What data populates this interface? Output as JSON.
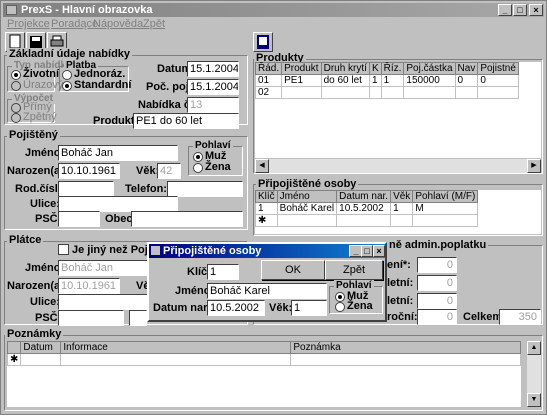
{
  "window": {
    "title": "PrexS - Hlavní obrazovka"
  },
  "menu": [
    "Projekce",
    "Poradące",
    "Nápověda",
    "Zpět"
  ],
  "basic": {
    "title": "Základní údaje nabídky",
    "typ_title": "Typ nabídky",
    "typ_opts": [
      "Životní",
      "Úrazový"
    ],
    "platba_title": "Platba",
    "platba_opts": [
      "Jednoráz.",
      "Standardní"
    ],
    "vypocet_title": "Výpočet",
    "vypocet_opts": [
      "Přímý",
      "Zpětný"
    ],
    "datum_label": "Datum:",
    "datum_value": "15.1.2004",
    "poc_label": "Poč. poj.:",
    "poc_value": "15.1.2004",
    "nabidka_label": "Nabídka č.:",
    "nabidka_value": "13",
    "produkt_label": "Produkt:",
    "produkt_value": "PE1 do 60 let"
  },
  "pojisteny": {
    "title": "Pojištěný",
    "jmeno_label": "Jméno:",
    "jmeno_value": "Boháč Jan",
    "narozen_label": "Narozen(a):",
    "narozen_value": "10.10.1961",
    "vek_label": "Věk:",
    "vek_value": "42",
    "pohlavi_title": "Pohlaví",
    "pohlavi_opts": [
      "Muž",
      "Žena"
    ],
    "rodc_label": "Rod.číslo:",
    "telefon_label": "Telefon:",
    "ulice_label": "Ulice:",
    "psc_label": "PSČ:",
    "obec_label": "Obec:"
  },
  "platce": {
    "title": "Plátce",
    "check_label": "Je jiný než Pojištěn",
    "jmeno_label": "Jméno:",
    "jmeno_value": "Boháč Jan",
    "narozen_label": "Narozen(a):",
    "narozen_value": "10.10.1961",
    "vek_label": "Vě",
    "ulice_label": "Ulice:",
    "psc_label": "PSČ:"
  },
  "produkty": {
    "title": "Produkty",
    "columns": [
      "Řád.",
      "Produkt",
      "Druh krytí",
      "K",
      "Říz.",
      "Poj.částka",
      "Nav",
      "Pojistné"
    ],
    "rows": [
      [
        "01",
        "PE1",
        "do 60 let",
        "1",
        "1",
        "150000",
        "0",
        "0"
      ],
      [
        "02",
        "",
        "",
        "",
        "",
        "",
        "",
        ""
      ]
    ]
  },
  "pripojistene": {
    "title": "Připojištěné osoby",
    "columns": [
      "Klíč",
      "Jméno",
      "Datum nar.",
      "Věk",
      "Pohlaví (M/F)"
    ],
    "rows": [
      [
        "1",
        "Boháč Karel",
        "10.5.2002",
        "1",
        "M"
      ]
    ]
  },
  "admin": {
    "title": "ně admin.poplatku",
    "rows": [
      {
        "label": "ení*:",
        "value": "0"
      },
      {
        "label": "letní:",
        "value": "0"
      },
      {
        "label": "letní:",
        "value": "0"
      },
      {
        "label": "roční:",
        "value": "0"
      }
    ],
    "celkem_label": "Celkem:",
    "celkem_value": "350"
  },
  "poznamky": {
    "title": "Poznámky",
    "columns": [
      "Datum",
      "Informace",
      "Poznámka"
    ]
  },
  "dialog": {
    "title": "Připojištěné osoby",
    "klic_label": "Klíč:",
    "klic_value": "1",
    "jmeno_label": "Jméno:",
    "jmeno_value": "Boháč Karel",
    "datum_label": "Datum nar.:",
    "datum_value": "10.5.2002",
    "vek_label": "Věk:",
    "vek_value": "1",
    "ok_label": "OK",
    "zpet_label": "Zpět",
    "pohlavi_title": "Pohlaví",
    "pohlavi_opts": [
      "Muž",
      "Žena"
    ]
  }
}
